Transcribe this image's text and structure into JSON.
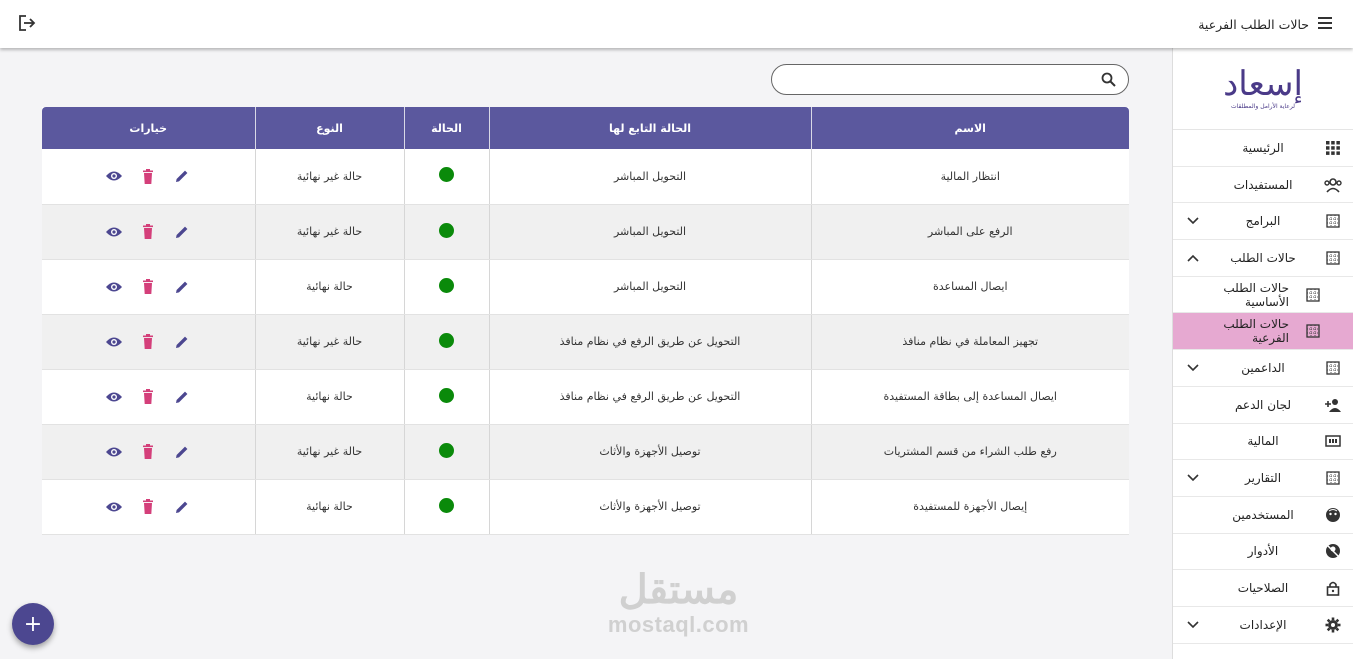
{
  "header": {
    "page_title": "حالات الطلب الفرعية",
    "menu_icon": "menu-icon",
    "logout_icon": "logout-icon"
  },
  "logo": {
    "glyph": "إسعاد",
    "subtitle": "لرعاية الأرامل والمطلقات"
  },
  "sidebar": {
    "items": [
      {
        "label": "الرئيسية",
        "icon": "apps-grid-icon"
      },
      {
        "label": "المستفيدات",
        "icon": "group-icon"
      },
      {
        "label": "البرامج",
        "icon": "grid-box-icon",
        "chevron": "down"
      },
      {
        "label": "حالات الطلب",
        "icon": "grid-box-icon",
        "chevron": "up"
      },
      {
        "label": "حالات الطلب الأساسية",
        "icon": "grid-box-icon"
      },
      {
        "label": "حالات الطلب الفرعية",
        "icon": "grid-box-icon",
        "active": true
      },
      {
        "label": "الداعمين",
        "icon": "grid-box-icon",
        "chevron": "down"
      },
      {
        "label": "لجان الدعم",
        "icon": "person-add-icon"
      },
      {
        "label": "المالية",
        "icon": "money-icon"
      },
      {
        "label": "التقارير",
        "icon": "grid-box-icon",
        "chevron": "down"
      },
      {
        "label": "المستخدمين",
        "icon": "face-icon"
      },
      {
        "label": "الأدوار",
        "icon": "no-accounts-icon"
      },
      {
        "label": "الصلاحيات",
        "icon": "lock-icon"
      },
      {
        "label": "الإعدادات",
        "icon": "gear-icon",
        "chevron": "down"
      }
    ]
  },
  "search": {
    "placeholder": "",
    "value": ""
  },
  "table": {
    "headers": [
      "الاسم",
      "الحالة التابع لها",
      "الحالة",
      "النوع",
      "خيارات"
    ],
    "rows": [
      {
        "name": "انتظار المالية",
        "parent": "التحويل المباشر",
        "type": "حالة غير نهائية"
      },
      {
        "name": "الرفع على المباشر",
        "parent": "التحويل المباشر",
        "type": "حالة غير نهائية"
      },
      {
        "name": "ايصال المساعدة",
        "parent": "التحويل المباشر",
        "type": "حالة نهائية"
      },
      {
        "name": "تجهيز المعاملة في نظام منافذ",
        "parent": "التحويل عن طريق الرفع في نظام منافذ",
        "type": "حالة غير نهائية"
      },
      {
        "name": "ايصال المساعدة إلى بطاقة المستفيدة",
        "parent": "التحويل عن طريق الرفع في نظام منافذ",
        "type": "حالة نهائية"
      },
      {
        "name": "رفع طلب الشراء من قسم المشتريات",
        "parent": "توصيل الأجهزة والأثاث",
        "type": "حالة غير نهائية"
      },
      {
        "name": "إيصال الأجهزة للمستفيدة",
        "parent": "توصيل الأجهزة والأثاث",
        "type": "حالة نهائية"
      }
    ],
    "status_color": "#0a8a0a",
    "action_icons": [
      "view-icon",
      "delete-icon",
      "edit-icon"
    ]
  },
  "watermark": {
    "arabic": "مستقل",
    "latin": "mostaql.com"
  },
  "fab": {
    "label": "+"
  },
  "colors": {
    "header": "#5b589e",
    "active": "#e6a9d1",
    "delete": "#d43f7a",
    "accent": "#4c4790"
  }
}
